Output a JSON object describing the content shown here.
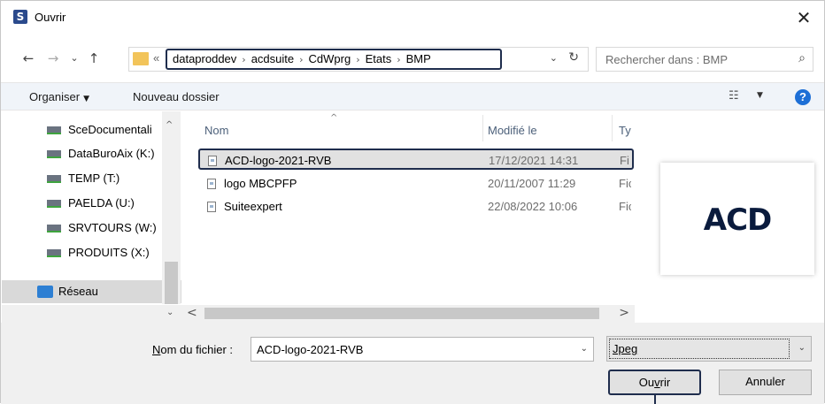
{
  "window": {
    "title": "Ouvrir",
    "app_icon_letter": "S",
    "close_glyph": "✕"
  },
  "nav": {
    "back_glyph": "←",
    "forward_glyph": "→",
    "recent_glyph": "⌄",
    "up_glyph": "↑",
    "breadcrumb_overflow": "«",
    "breadcrumb": [
      "dataproddev",
      "acdsuite",
      "CdWprg",
      "Etats",
      "BMP"
    ],
    "breadcrumb_sep": "›",
    "dropdown_glyph": "⌄",
    "refresh_glyph": "↻",
    "search_placeholder": "Rechercher dans : BMP",
    "search_glyph": "⌕"
  },
  "toolbar": {
    "organiser": "Organiser",
    "organiser_caret": "▼",
    "new_folder": "Nouveau dossier",
    "view_glyph": "☷",
    "view_caret": "▼",
    "help": "?"
  },
  "sidebar": {
    "items": [
      {
        "label": "SceDocumentali",
        "icon": "network-drive-icon"
      },
      {
        "label": "DataBuroAix (K:)",
        "icon": "network-drive-icon"
      },
      {
        "label": "TEMP (T:)",
        "icon": "network-drive-icon"
      },
      {
        "label": "PAELDA (U:)",
        "icon": "network-drive-icon"
      },
      {
        "label": "SRVTOURS (W:)",
        "icon": "network-drive-icon"
      },
      {
        "label": "PRODUITS (X:)",
        "icon": "network-drive-icon"
      }
    ],
    "network": {
      "label": "Réseau",
      "icon": "network-icon"
    },
    "scroll_up": "^",
    "scroll_down": "⌄"
  },
  "filelist": {
    "columns": {
      "name": "Nom",
      "modified": "Modifié le",
      "type": "Ty"
    },
    "sort_caret": "^",
    "rows": [
      {
        "name": "ACD-logo-2021-RVB",
        "date": "17/12/2021 14:31",
        "type": "Fi",
        "selected": true
      },
      {
        "name": "logo MBCPFP",
        "date": "20/11/2007 11:29",
        "type": "Fic",
        "selected": false
      },
      {
        "name": "Suiteexpert",
        "date": "22/08/2022 10:06",
        "type": "Fic",
        "selected": false
      }
    ],
    "hscroll_left": "<",
    "hscroll_right": ">"
  },
  "preview": {
    "logo_text": "ACD"
  },
  "footer": {
    "filename_label_prefix": "N",
    "filename_label_rest": "om du fichier :",
    "filename_value": "ACD-logo-2021-RVB",
    "filename_dd": "⌄",
    "filetype_value": "Jpeg",
    "filetype_dd": "⌄",
    "open_button_prefix": "Ou",
    "open_button_underline": "v",
    "open_button_suffix": "rir",
    "cancel_button": "Annuler"
  },
  "colors": {
    "accent_border": "#1f2d4d",
    "help_blue": "#1d6fd6",
    "folder_yellow": "#f2c45a"
  }
}
